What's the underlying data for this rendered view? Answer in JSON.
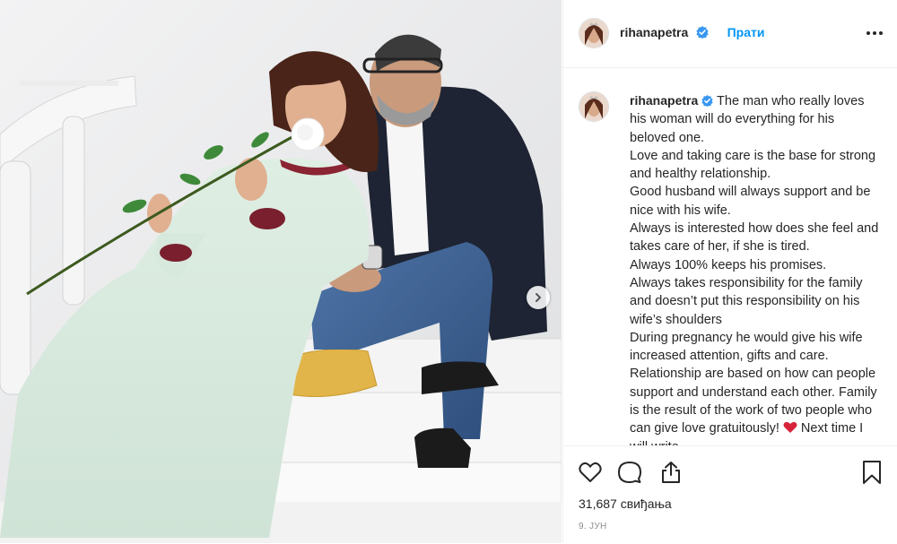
{
  "post": {
    "username": "rihanapetra",
    "follow_label": "Прати",
    "caption": [
      "The man who really loves his woman will do everything for his beloved one.",
      "Love and taking care is the base for strong and healthy relationship.",
      "Good husband will always support and be nice with his wife.",
      "Always is interested how does she feel and takes care of her, if she is tired.",
      "Always 100% keeps his promises.",
      "Always takes responsibility for the family and doesn’t put this responsibility on his wife’s shoulders",
      "During pregnancy he would give his wife increased attention, gifts and care.",
      "Relationship are based on how can people support and understand each other. Family is the result of the work of two people who can give love gratuitously!",
      "Next time I will write"
    ],
    "likes": "31,687 свиђања",
    "date": "9. ЈУН"
  },
  "icons": {
    "verified": "verified-badge-icon",
    "more": "more-options-icon",
    "like": "heart-icon",
    "comment": "comment-icon",
    "share": "share-icon",
    "save": "bookmark-icon",
    "next": "chevron-right-icon",
    "emoji": "red-heart-emoji"
  },
  "colors": {
    "accent": "#0095f6",
    "text": "#262626",
    "muted": "#8e8e8e",
    "heart": "#ed4956"
  }
}
